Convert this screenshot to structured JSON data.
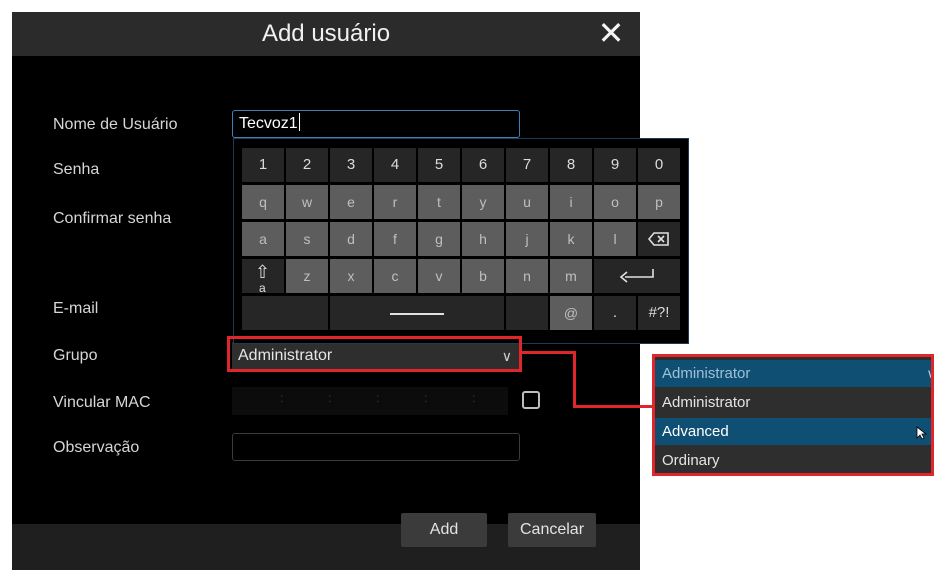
{
  "dialog": {
    "title": "Add usuário",
    "close_label": "✕",
    "labels": {
      "username": "Nome de Usuário",
      "password": "Senha",
      "confirm_password": "Confirmar senha",
      "email": "E-mail",
      "group": "Grupo",
      "bind_mac": "Vincular MAC",
      "note": "Observação"
    },
    "username_value": "Tecvoz1",
    "group_selected": "Administrator",
    "mac_separators": ":",
    "buttons": {
      "add": "Add",
      "cancel": "Cancelar"
    }
  },
  "keyboard": {
    "row1": [
      "1",
      "2",
      "3",
      "4",
      "5",
      "6",
      "7",
      "8",
      "9",
      "0"
    ],
    "row2": [
      "q",
      "w",
      "e",
      "r",
      "t",
      "y",
      "u",
      "i",
      "o",
      "p"
    ],
    "row3": [
      "a",
      "s",
      "d",
      "f",
      "g",
      "h",
      "j",
      "k",
      "l"
    ],
    "row4": [
      "z",
      "x",
      "c",
      "v",
      "b",
      "n",
      "m"
    ],
    "shift_sub": "a",
    "at": "@",
    "dot": ".",
    "symbols": "#?!"
  },
  "dropdown": {
    "selected": "Administrator",
    "options": [
      "Administrator",
      "Advanced",
      "Ordinary"
    ],
    "highlighted_option": "Advanced"
  },
  "colors": {
    "accent_red": "#e0262b",
    "highlight_blue": "#0f4f73",
    "focus_border": "#3e7fb5"
  }
}
